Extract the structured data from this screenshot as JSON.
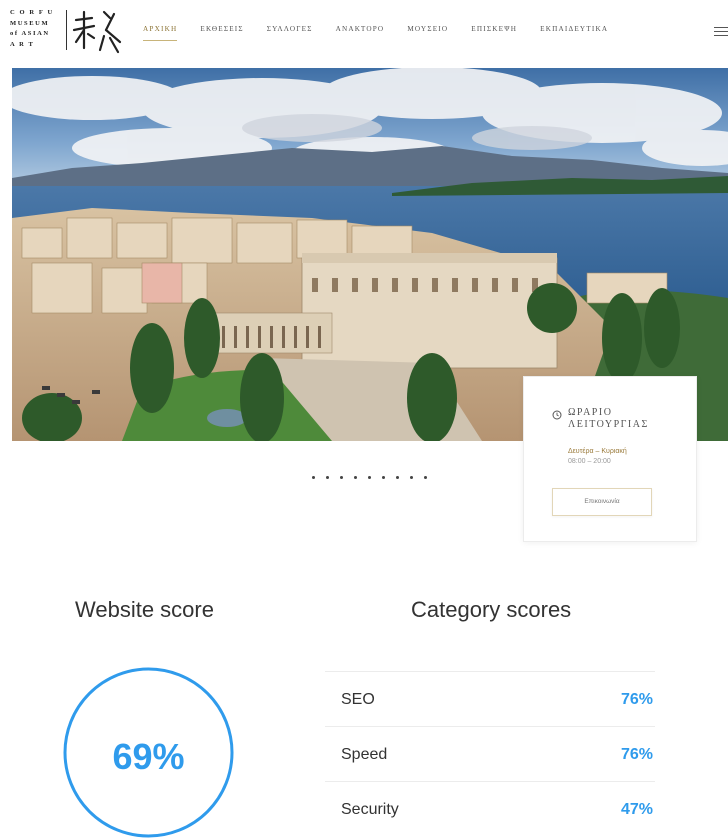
{
  "logo": {
    "lines": [
      "C O R F U",
      "MUSEUM",
      "of ASIAN",
      "A   R   T"
    ]
  },
  "nav": {
    "items": [
      {
        "label": "ΑΡΧΙΚΗ",
        "active": true
      },
      {
        "label": "ΕΚΘΕΣΕΙΣ",
        "active": false
      },
      {
        "label": "ΣΥΛΛΟΓΕΣ",
        "active": false
      },
      {
        "label": "ΑΝΑΚΤΟΡΟ",
        "active": false
      },
      {
        "label": "ΜΟΥΣΕΙΟ",
        "active": false
      },
      {
        "label": "ΕΠΙΣΚΕΨΗ",
        "active": false
      },
      {
        "label": "ΕΚΠΑΙΔΕΥΤΙΚΑ",
        "active": false
      }
    ],
    "menu_icon": "hamburger-icon"
  },
  "hours_card": {
    "icon": "clock-icon",
    "title_line1": "ΩΡΑΡΙΟ",
    "title_line2": "ΛΕΙΤΟΥΡΓΙΑΣ",
    "days": "Δευτέρα – Κυριακή",
    "time": "08:00 – 20:00",
    "button_label": "Επικοινωνία"
  },
  "slider": {
    "dot_count": 9
  },
  "scores": {
    "website_title": "Website score",
    "website_value": "69%",
    "website_fraction": 0.69,
    "category_title": "Category scores",
    "categories": [
      {
        "name": "SEO",
        "value": "76%"
      },
      {
        "name": "Speed",
        "value": "76%"
      },
      {
        "name": "Security",
        "value": "47%"
      }
    ]
  },
  "colors": {
    "accent": "#2f9bec",
    "nav_active": "#8c7436",
    "text": "#333333"
  }
}
